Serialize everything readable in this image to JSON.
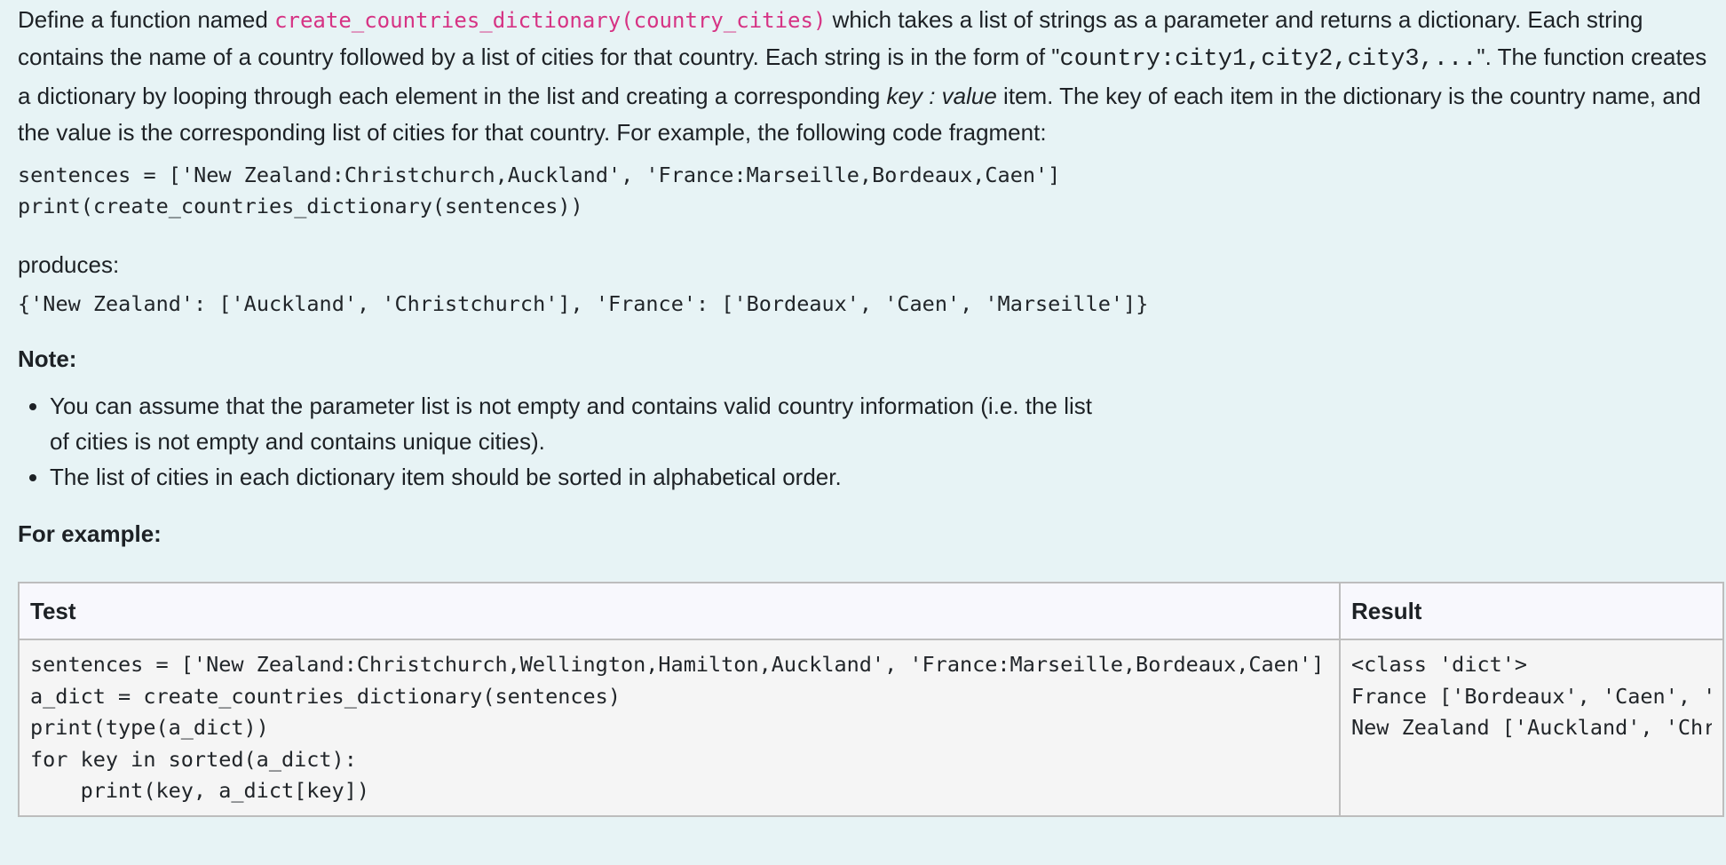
{
  "intro": {
    "t1": "Define a function named ",
    "func_sig": "create_countries_dictionary(country_cities)",
    "t2": " which takes a list of strings as a parameter and returns a dictionary. Each string contains the name of a country followed by a list of cities for that country. Each string is in the form of \"",
    "format_code": "country:city1,city2,city3,...",
    "t3": "\". The function creates a dictionary by looping through each element in the list and creating a corresponding ",
    "key_value": "key : value",
    "t4": " item. The key of each item in the dictionary is the country name, and the value is the corresponding list of cities for that country. For example, the following code fragment:"
  },
  "example_code": "sentences = ['New Zealand:Christchurch,Auckland', 'France:Marseille,Bordeaux,Caen']\nprint(create_countries_dictionary(sentences))",
  "produces_label": "produces:",
  "example_output": "{'New Zealand': ['Auckland', 'Christchurch'], 'France': ['Bordeaux', 'Caen', 'Marseille']}",
  "note_heading": "Note:",
  "notes": [
    "You can assume that the parameter list is not empty and contains valid country information (i.e. the list of cities is not empty and contains unique cities).",
    "The list of cities in each dictionary item should be sorted in alphabetical order."
  ],
  "for_example_heading": "For example:",
  "table": {
    "headers": [
      "Test",
      "Result"
    ],
    "rows": [
      {
        "test": "sentences = ['New Zealand:Christchurch,Wellington,Hamilton,Auckland', 'France:Marseille,Bordeaux,Caen']\na_dict = create_countries_dictionary(sentences)\nprint(type(a_dict))\nfor key in sorted(a_dict):\n    print(key, a_dict[key])",
        "result": "<class 'dict'>\nFrance ['Bordeaux', 'Caen', 'Marseille']\nNew Zealand ['Auckland', 'Christchurch', 'Hamilton', 'Wellington']"
      }
    ]
  }
}
